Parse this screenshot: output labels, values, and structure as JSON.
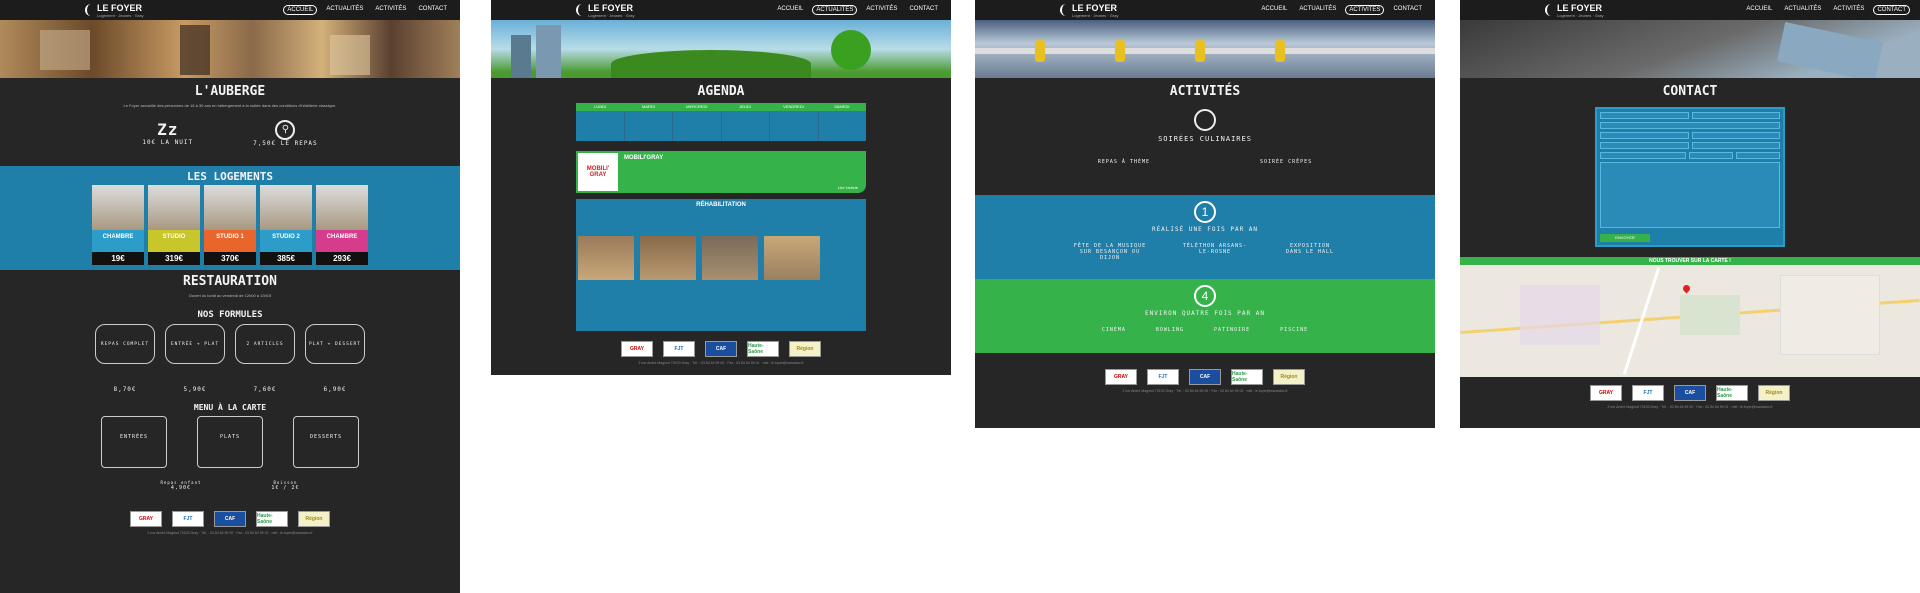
{
  "site": {
    "logo_title": "LE FOYER",
    "logo_sub": "Logement · Jeunes · Gray"
  },
  "nav": [
    "ACCUEIL",
    "ACTUALITÉS",
    "ACTIVITÉS",
    "CONTACT"
  ],
  "page1": {
    "auberge_title": "L'AUBERGE",
    "auberge_intro": "Le Foyer accueille des personnes de 16 à 30 ans en hébergement à la nuitée dans des conditions d'hôtellerie classique.",
    "nuit_label": "10€ LA NUIT",
    "repas_label": "7,50€ LE REPAS",
    "logements_title": "LES LOGEMENTS",
    "rooms": [
      {
        "name": "CHAMBRE",
        "price": "19€",
        "color": "#2c9cc9"
      },
      {
        "name": "STUDIO",
        "price": "319€",
        "color": "#c8c62a"
      },
      {
        "name": "STUDIO 1",
        "price": "370€",
        "color": "#e8652c"
      },
      {
        "name": "STUDIO 2",
        "price": "385€",
        "color": "#2c9cc9"
      },
      {
        "name": "CHAMBRE",
        "price": "293€",
        "color": "#d63c8c"
      }
    ],
    "resto_title": "RESTAURATION",
    "resto_sub": "Ouvert du lundi au vendredi de 12h00 à 13h15",
    "formules_title": "NOS FORMULES",
    "formules": [
      {
        "name": "REPAS COMPLET",
        "price": "8,70€"
      },
      {
        "name": "ENTRÉE + PLAT",
        "price": "5,90€"
      },
      {
        "name": "2 ARTICLES",
        "price": "7,60€"
      },
      {
        "name": "PLAT + DESSERT",
        "price": "6,90€"
      }
    ],
    "carte_title": "MENU À LA CARTE",
    "carte": [
      "ENTRÉES",
      "PLATS",
      "DESSERTS"
    ],
    "extra": [
      {
        "name": "Repas enfant",
        "price": "4,90€"
      },
      {
        "name": "Boisson",
        "price": "1€ / 2€"
      }
    ]
  },
  "page2": {
    "agenda_title": "AGENDA",
    "days": [
      "LUNDI",
      "MARDI",
      "MERCREDI",
      "JEUDI",
      "VENDREDI",
      "SAMEDI"
    ],
    "news1_title": "MOBILI'GRAY",
    "news1_logo": "MOBILI' GRAY",
    "news1_link": "Lire l'article",
    "news2_title": "RÉHABILITATION"
  },
  "page3": {
    "title": "ACTIVITÉS",
    "cuisine": "SOIRÉES CULINAIRES",
    "cuisine_items": [
      "REPAS À THÈME",
      "SOIRÉE CRÊPES"
    ],
    "once_label": "RÉALISÉ UNE FOIS PAR AN",
    "once_num": "1",
    "once_items": [
      "FÊTE DE LA MUSIQUE SUR BESANÇON OU DIJON",
      "TÉLÉTHON ARSANS-LE-ROSNE",
      "EXPOSITION DANS LE HALL"
    ],
    "four_label": "ENVIRON QUATRE FOIS PAR AN",
    "four_num": "4",
    "four_items": [
      "CINÉMA",
      "BOWLING",
      "PATINOIRE",
      "PISCINE"
    ]
  },
  "page4": {
    "title": "CONTACT",
    "submit": "ENVOYER",
    "map_title": "NOUS TROUVER SUR LA CARTE !"
  },
  "footer": {
    "logos": [
      "GRAY",
      "FJT",
      "CAF",
      "Haute-Saône",
      "Région"
    ],
    "address": "2 rue André Maginot 70100 Gray · Tél. : 03 84 64 99 00 · Fax : 03 84 64 99 01 · mél : le-foyer@wanadoo.fr"
  },
  "colors": {
    "chalkboard": "#262626",
    "blue": "#1f7fa8",
    "green": "#35b34a"
  }
}
